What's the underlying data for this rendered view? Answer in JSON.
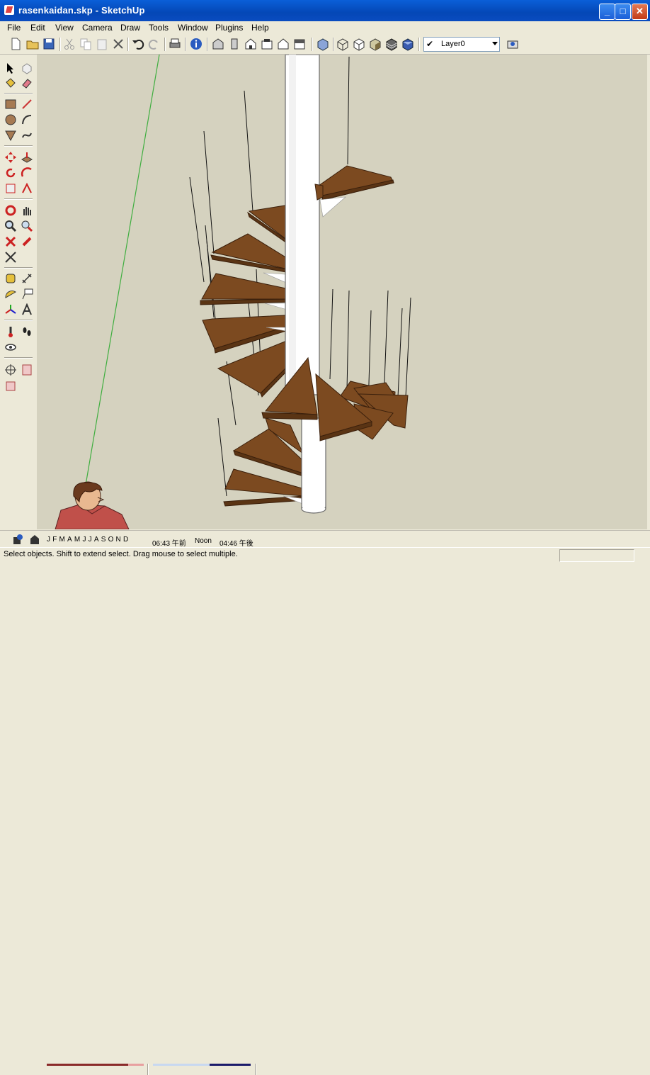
{
  "window": {
    "title": "rasenkaidan.skp - SketchUp",
    "minimize": "_",
    "maximize": "□",
    "close": "✕"
  },
  "menu": [
    "File",
    "Edit",
    "View",
    "Camera",
    "Draw",
    "Tools",
    "Window",
    "Plugins",
    "Help"
  ],
  "toolbar": {
    "layer": "Layer0"
  },
  "shadow": {
    "months": "JFMAMJJASOND",
    "time_start": "06:43 午前",
    "time_noon": "Noon",
    "time_end": "04:46 午後"
  },
  "status": {
    "hint": "Select objects. Shift to extend select. Drag mouse to select multiple."
  },
  "colors": {
    "wood": "#7c4a20",
    "wood_edge": "#3b200c",
    "viewport_bg": "#d5d2bf",
    "axis_green": "#3fae3f",
    "column": "#ffffff"
  }
}
